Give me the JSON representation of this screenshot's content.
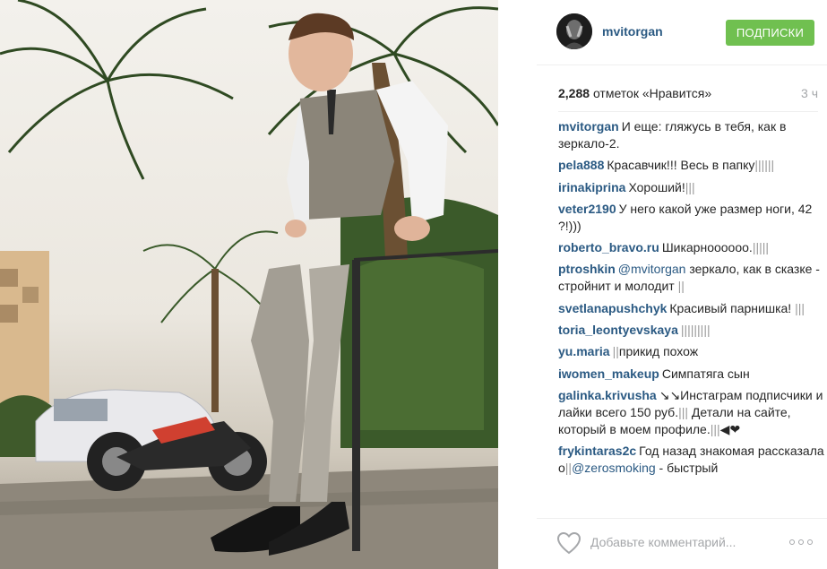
{
  "photo": {
    "alt": "",
    "subject_icon": "person-standing-photo"
  },
  "header": {
    "username": "mvitorgan",
    "follow_label": "ПОДПИСКИ",
    "avatar_icon": "avatar-icon"
  },
  "stats": {
    "likes_count": "2,288",
    "likes_label": "отметок «Нравится»",
    "timestamp": "3 ч"
  },
  "comments": [
    {
      "user": "mvitorgan",
      "parts": [
        {
          "t": "text",
          "v": "И еще: гляжусь в тебя, как в зеркало-2."
        }
      ]
    },
    {
      "user": "pela888",
      "parts": [
        {
          "t": "text",
          "v": "Красавчик!!! Весь в папку"
        },
        {
          "t": "bars",
          "v": "||||||"
        }
      ]
    },
    {
      "user": "irinakiprina",
      "parts": [
        {
          "t": "text",
          "v": "Хороший!"
        },
        {
          "t": "bars",
          "v": "|||"
        }
      ]
    },
    {
      "user": "veter2190",
      "parts": [
        {
          "t": "text",
          "v": "У него какой уже размер ноги, 42 ?!)))"
        }
      ]
    },
    {
      "user": "roberto_bravo.ru",
      "parts": [
        {
          "t": "text",
          "v": "Шикарноооооо."
        },
        {
          "t": "bars",
          "v": "|||||"
        }
      ]
    },
    {
      "user": "ptroshkin",
      "parts": [
        {
          "t": "mention",
          "v": "@mvitorgan"
        },
        {
          "t": "text",
          "v": " зеркало, как в сказке - стройнит и молодит "
        },
        {
          "t": "bars",
          "v": "||"
        }
      ]
    },
    {
      "user": "svetlanapushchyk",
      "parts": [
        {
          "t": "text",
          "v": "Красивый парнишка! "
        },
        {
          "t": "bars",
          "v": "|||"
        }
      ]
    },
    {
      "user": "toria_leontyevskaya",
      "parts": [
        {
          "t": "bars",
          "v": "|||||||||"
        }
      ]
    },
    {
      "user": "yu.maria",
      "parts": [
        {
          "t": "bars",
          "v": "||"
        },
        {
          "t": "text",
          "v": "прикид похож"
        }
      ]
    },
    {
      "user": "iwomen_makeup",
      "parts": [
        {
          "t": "text",
          "v": "Симпатяга сын"
        }
      ]
    },
    {
      "user": "galinka.krivusha",
      "parts": [
        {
          "t": "text",
          "v": "↘↘Инстаграм подписчики и лайки всего 150 руб."
        },
        {
          "t": "bars",
          "v": "|||"
        },
        {
          "t": "text",
          "v": " Детали на сайте, который в моем профиле."
        },
        {
          "t": "bars",
          "v": "|||"
        },
        {
          "t": "text",
          "v": "◀❤"
        }
      ]
    },
    {
      "user": "frykintaras2c",
      "parts": [
        {
          "t": "text",
          "v": "Год назад знакомая рассказала о"
        },
        {
          "t": "bars",
          "v": "||"
        },
        {
          "t": "mention",
          "v": "@zerosmoking"
        },
        {
          "t": "text",
          "v": " - быстрый"
        }
      ]
    }
  ],
  "footer": {
    "comment_placeholder": "Добавьте комментарий...",
    "like_icon": "heart-icon",
    "more_icon": "more-options-icon"
  },
  "colors": {
    "username": "#2b5a83",
    "follow_button": "#70c050",
    "muted": "#a5a7aa"
  }
}
